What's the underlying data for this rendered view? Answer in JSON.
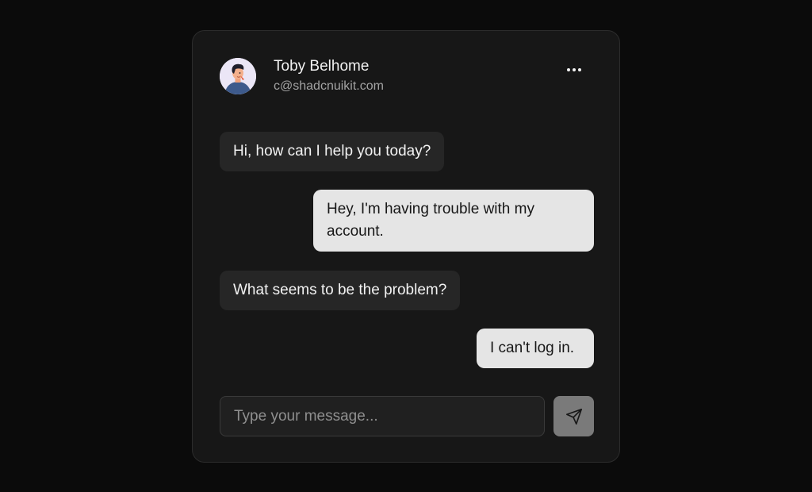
{
  "header": {
    "name": "Toby Belhome",
    "email": "c@shadcnuikit.com",
    "avatar_icon": "avatar-illustration",
    "more_icon": "more-horizontal-icon"
  },
  "messages": [
    {
      "from": "agent",
      "text": "Hi, how can I help you today?"
    },
    {
      "from": "user",
      "text": "Hey, I'm having trouble with my account."
    },
    {
      "from": "agent",
      "text": "What seems to be the problem?"
    },
    {
      "from": "user",
      "text": "I can't log in."
    }
  ],
  "composer": {
    "placeholder": "Type your message...",
    "value": "",
    "send_icon": "send-icon"
  },
  "colors": {
    "page_bg": "#0b0b0b",
    "card_bg": "#171717",
    "incoming_bubble": "#262626",
    "outgoing_bubble": "#e5e5e5",
    "send_button": "#7a7a7a"
  }
}
